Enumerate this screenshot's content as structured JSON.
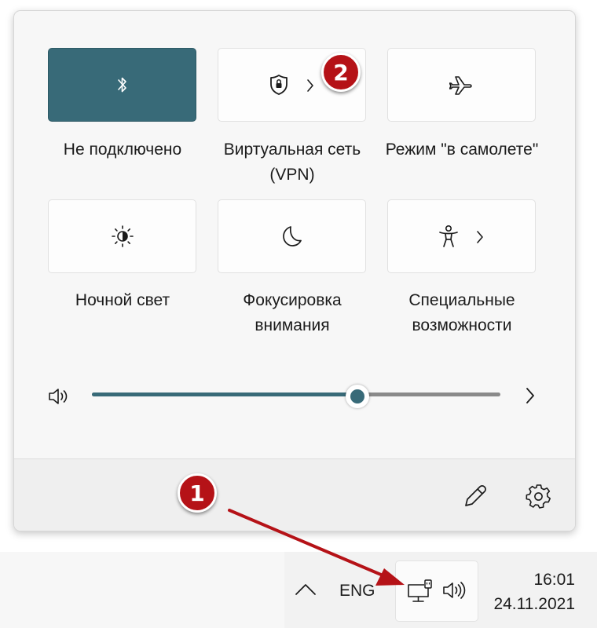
{
  "quick_settings": {
    "tiles": [
      {
        "label": "Не подключено",
        "icon": "bluetooth-icon",
        "active": true
      },
      {
        "label": "Виртуальная сеть (VPN)",
        "icon": "vpn-shield-icon",
        "active": false,
        "has_chevron": true
      },
      {
        "label": "Режим \"в самолете\"",
        "icon": "airplane-icon",
        "active": false
      },
      {
        "label": "Ночной свет",
        "icon": "night-light-icon",
        "active": false
      },
      {
        "label": "Фокусировка внимания",
        "icon": "focus-moon-icon",
        "active": false
      },
      {
        "label": "Специальные возможности",
        "icon": "accessibility-icon",
        "active": false,
        "has_chevron": true
      }
    ],
    "volume": {
      "level_fraction": 0.65
    }
  },
  "taskbar": {
    "language": "ENG",
    "time": "16:01",
    "date": "24.11.2021"
  },
  "annotations": {
    "badge_1": "1",
    "badge_2": "2"
  },
  "colors": {
    "accent": "#386a78",
    "badge": "#b51217"
  }
}
